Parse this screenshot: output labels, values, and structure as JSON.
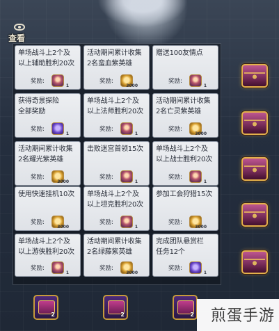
{
  "header": {
    "view_label": "查看"
  },
  "reward_label": "奖励:",
  "tasks": [
    {
      "title": "单场战斗上2个及\n以上辅助胜利20次",
      "reward_qty": "1",
      "reward_kind": "portrait"
    },
    {
      "title": "活动期间累计收集\n2名蛮血紫英雄",
      "reward_qty": "3000",
      "reward_kind": "coin"
    },
    {
      "title": "赠送100友情点",
      "reward_qty": "1",
      "reward_kind": "portrait"
    },
    {
      "title": "获得奇景探险\n全部奖励",
      "reward_qty": "1",
      "reward_kind": "gem"
    },
    {
      "title": "单场战斗上2个及\n以上法师胜利20次",
      "reward_qty": "1",
      "reward_kind": "portrait"
    },
    {
      "title": "活动期间累计收集\n2名亡灵紫英雄",
      "reward_qty": "3000",
      "reward_kind": "coin"
    },
    {
      "title": "活动期间累计收集\n2名耀光紫英雄",
      "reward_qty": "3000",
      "reward_kind": "coin"
    },
    {
      "title": "击败迷宫首领15次",
      "reward_qty": "1",
      "reward_kind": "portrait"
    },
    {
      "title": "单场战斗上2个及\n以上战士胜利20次",
      "reward_qty": "1",
      "reward_kind": "portrait"
    },
    {
      "title": "使用快速挂机10次",
      "reward_qty": "3000",
      "reward_kind": "coin"
    },
    {
      "title": "单场战斗上2个及\n以上坦克胜利20次",
      "reward_qty": "1",
      "reward_kind": "portrait"
    },
    {
      "title": "参加工会狩猎15次",
      "reward_qty": "3000",
      "reward_kind": "coin"
    },
    {
      "title": "单场战斗上2个及\n以上游侠胜利20次",
      "reward_qty": "1",
      "reward_kind": "portrait"
    },
    {
      "title": "活动期间累计收集\n2名绿藤紫英雄",
      "reward_qty": "3000",
      "reward_kind": "coin"
    },
    {
      "title": "完成团队悬赏栏\n任务12个",
      "reward_qty": "1",
      "reward_kind": "gem"
    }
  ],
  "row_chests": [
    "chest-icon",
    "chest-icon",
    "chest-icon",
    "chest-icon",
    "chest-icon"
  ],
  "bottom_chests": [
    {
      "qty": "2"
    },
    {
      "qty": "2"
    },
    {
      "qty": "2"
    }
  ],
  "watermark": "煎蛋手游"
}
